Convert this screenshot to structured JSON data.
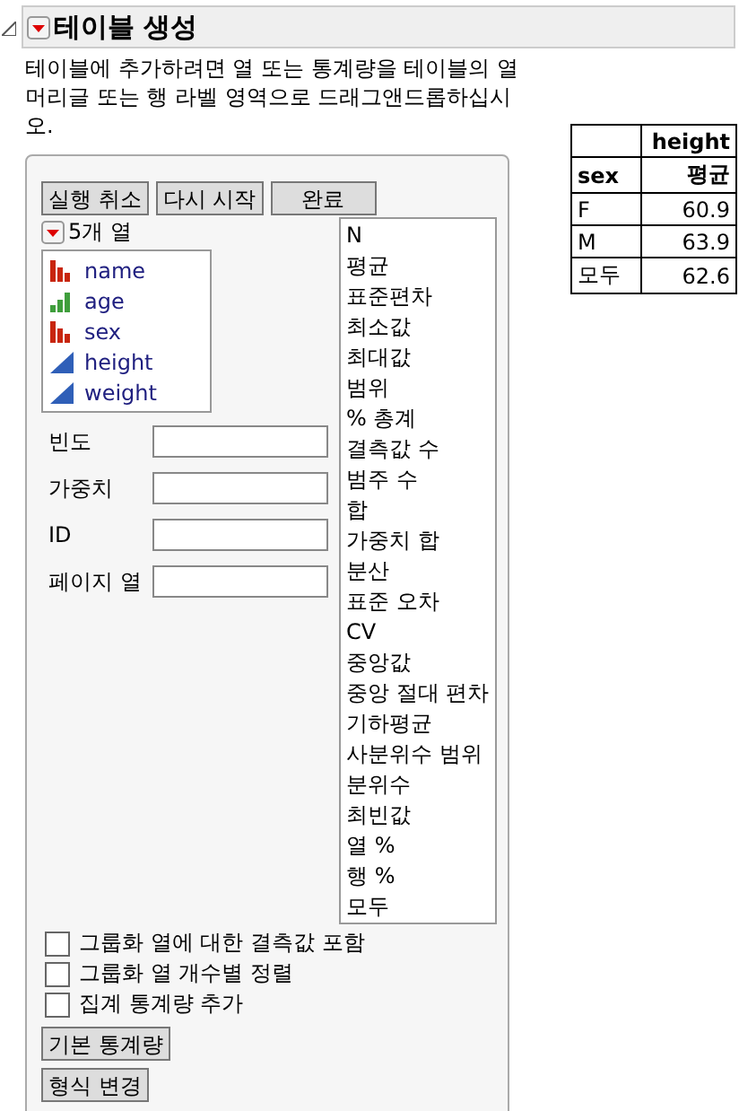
{
  "title": "테이블 생성",
  "description": "테이블에 추가하려면 열 또는 통계량을 테이블의 열 머리글 또는 행 라벨 영역으로 드래그앤드롭하십시오.",
  "action_buttons": [
    "실행 취소",
    "다시 시작",
    "완료"
  ],
  "columns_header": "5개 열",
  "columns": [
    {
      "name": "name",
      "kind": "nominal"
    },
    {
      "name": "age",
      "kind": "ordinal"
    },
    {
      "name": "sex",
      "kind": "nominal"
    },
    {
      "name": "height",
      "kind": "continuous"
    },
    {
      "name": "weight",
      "kind": "continuous"
    }
  ],
  "roles": [
    {
      "label": "빈도"
    },
    {
      "label": "가중치"
    },
    {
      "label": "ID"
    },
    {
      "label": "페이지 열"
    }
  ],
  "statistics": [
    "N",
    "평균",
    "표준편차",
    "최소값",
    "최대값",
    "범위",
    "% 총계",
    "결측값 수",
    "범주 수",
    "합",
    "가중치 합",
    "분산",
    "표준 오차",
    "CV",
    "중앙값",
    "중앙 절대 편차",
    "기하평균",
    "사분위수 범위",
    "분위수",
    "최빈값",
    "열 %",
    "행 %",
    "모두"
  ],
  "options": [
    {
      "label": "그룹화 열에 대한 결측값 포함",
      "checked": false
    },
    {
      "label": "그룹화 열 개수별 정렬",
      "checked": false
    },
    {
      "label": "집계 통계량 추가",
      "checked": false
    }
  ],
  "bottom_buttons": [
    "기본 통계량",
    "형식 변경"
  ],
  "result_table": {
    "column_header": "height",
    "row_label_header": "sex",
    "statistic": "평균",
    "rows": [
      {
        "label": "F",
        "value": "60.9"
      },
      {
        "label": "M",
        "value": "63.9"
      },
      {
        "label": "모두",
        "value": "62.6"
      }
    ]
  }
}
